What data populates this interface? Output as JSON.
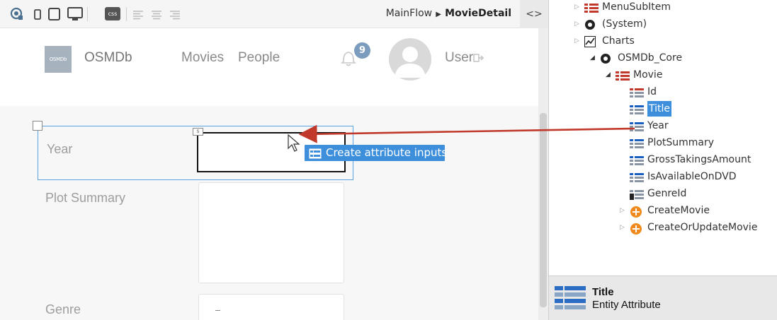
{
  "toolbar": {
    "icons": [
      "device-select-icon",
      "phone-icon",
      "tablet-icon",
      "desktop-icon",
      "css-icon",
      "align-left-icon",
      "align-center-icon",
      "align-right-icon"
    ],
    "css_label": "css",
    "breadcrumb_flow": "MainFlow",
    "breadcrumb_screen": "MovieDetail",
    "code_toggle": "<>"
  },
  "app_header": {
    "logo_text": "OSMDb",
    "app_name": "OSMDb",
    "nav": [
      "Movies",
      "People"
    ],
    "notification_count": "9",
    "user_name": "User"
  },
  "form": {
    "labels": [
      "Year",
      "Plot Summary",
      "Genre"
    ],
    "drop_handle": "$",
    "tooltip": "Create attribute inputs"
  },
  "tree": [
    {
      "label": "MenuSubItem",
      "icon": "entity-icon",
      "caret": "collapsed"
    },
    {
      "label": "(System)",
      "icon": "module-icon",
      "caret": "collapsed"
    },
    {
      "label": "Charts",
      "icon": "chart-icon",
      "caret": "collapsed"
    },
    {
      "label": "OSMDb_Core",
      "icon": "module-icon",
      "caret": "expanded"
    },
    {
      "label": "Movie",
      "icon": "entity-icon",
      "caret": "expanded"
    },
    {
      "label": "Id",
      "icon": "attribute-key-icon",
      "caret": "none"
    },
    {
      "label": "Title",
      "icon": "attribute-icon",
      "caret": "none",
      "selected": true
    },
    {
      "label": "Year",
      "icon": "attribute-icon",
      "caret": "none"
    },
    {
      "label": "PlotSummary",
      "icon": "attribute-icon",
      "caret": "none"
    },
    {
      "label": "GrossTakingsAmount",
      "icon": "attribute-icon",
      "caret": "none"
    },
    {
      "label": "IsAvailableOnDVD",
      "icon": "attribute-icon",
      "caret": "none"
    },
    {
      "label": "GenreId",
      "icon": "attribute-reference-icon",
      "caret": "none"
    },
    {
      "label": "CreateMovie",
      "icon": "action-icon",
      "caret": "collapsed"
    },
    {
      "label": "CreateOrUpdateMovie",
      "icon": "action-icon",
      "caret": "collapsed"
    }
  ],
  "info_panel": {
    "title": "Title",
    "subtitle": "Entity Attribute"
  },
  "colors": {
    "accent": "#3d8fdc",
    "drag_arrow": "#c0392b",
    "badge": "#7c9cbd"
  }
}
